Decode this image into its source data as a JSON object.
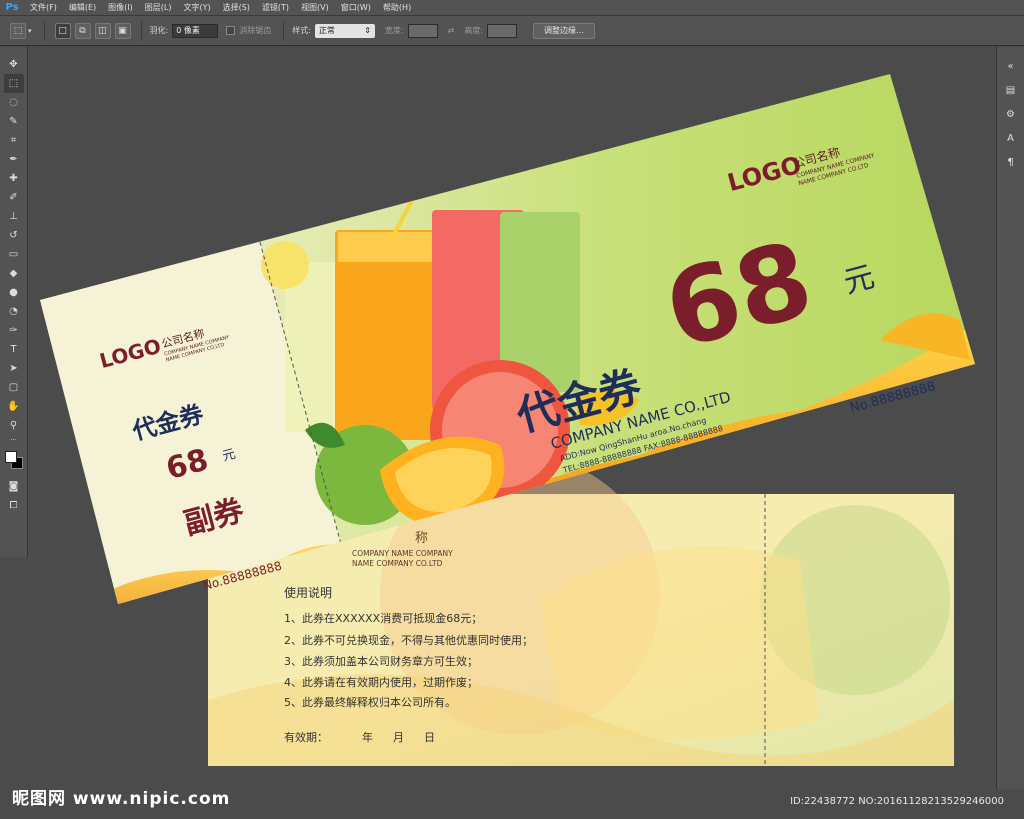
{
  "app": {
    "logo": "Ps"
  },
  "menu": [
    "文件(F)",
    "编辑(E)",
    "图像(I)",
    "图层(L)",
    "文字(Y)",
    "选择(S)",
    "滤镜(T)",
    "视图(V)",
    "窗口(W)",
    "帮助(H)"
  ],
  "options": {
    "feather_label": "羽化:",
    "feather_value": "0 像素",
    "antialias_label": "消除锯齿",
    "style_label": "样式:",
    "style_value": "正常",
    "width_label": "宽度:",
    "height_label": "高度:",
    "refine_edge_button": "调整边缘..."
  },
  "voucher_front": {
    "stub_logo": "LOGO",
    "stub_company": "公司名称",
    "stub_company_en_1": "COMPANY NAME COMPANY",
    "stub_company_en_2": "NAME COMPANY CO.LTD",
    "stub_title": "代金券",
    "stub_amount": "68",
    "stub_unit": "元",
    "stub_copy": "副券",
    "stub_no": "No.88888888",
    "main_logo": "LOGO",
    "main_company": "公司名称",
    "main_company_en_1": "COMPANY NAME COMPANY",
    "main_company_en_2": "NAME COMPANY CO.LTD",
    "main_title": "代金券",
    "main_amount": "68",
    "main_unit": "元",
    "company_name": "COMPANY NAME CO.,LTD",
    "address": "ADD:Now QingShanHu aroa.No.chang",
    "tel_fax": "TEL:8888-88888888  FAX:8888-88888888",
    "main_no": "No.88888888"
  },
  "voucher_back": {
    "company_partial": "称",
    "company_en_1": "COMPANY NAME COMPANY",
    "company_en_2": "NAME COMPANY CO.LTD",
    "instructions_title": "使用说明",
    "rules": [
      "1、此券在XXXXXX消费可抵现金68元；",
      "2、此券不可兑换现金，不得与其他优惠同时使用；",
      "3、此券须加盖本公司财务章方可生效；",
      "4、此券请在有效期内使用，过期作废；",
      "5、此券最终解释权归本公司所有。"
    ],
    "validity_label": "有效期：",
    "validity_year": "年",
    "validity_month": "月",
    "validity_day": "日"
  },
  "watermark": {
    "site": "昵图网 www.nipic.com",
    "id": "ID:22438772 NO:20161128213529246000"
  },
  "colors": {
    "ps_bg": "#535353",
    "canvas_bg": "#4b4b4b",
    "voucher_green": "#c8e07a",
    "title_navy": "#1f2d5a",
    "amount_maroon": "#7b1e2b",
    "juice_orange": "#f7a21b"
  }
}
